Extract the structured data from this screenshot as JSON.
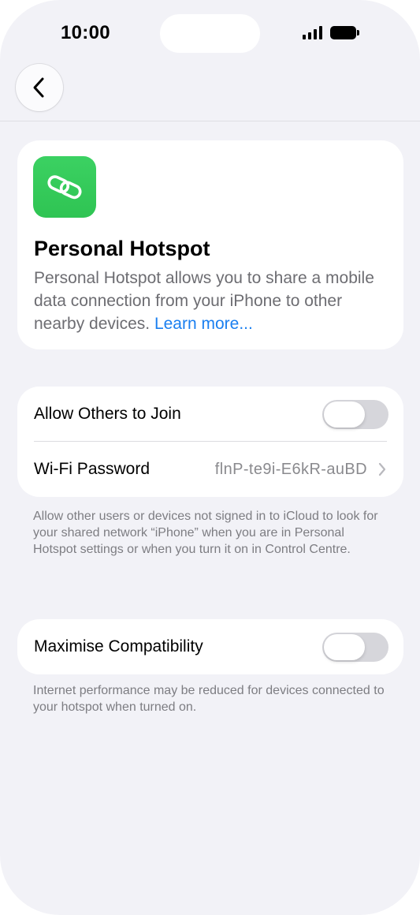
{
  "status_bar": {
    "time": "10:00",
    "signal_icon": "cellular-signal-icon",
    "battery_icon": "battery-icon"
  },
  "nav": {
    "back_icon": "chevron-left-icon"
  },
  "hero": {
    "icon": "link-chain-icon",
    "icon_color": "#34c759",
    "title": "Personal Hotspot",
    "description": "Personal Hotspot allows you to share a mobile data connection from your iPhone to other nearby devices.",
    "link_label": "Learn more..."
  },
  "settings": {
    "allow_others_label": "Allow Others to Join",
    "allow_others_enabled": false,
    "wifi_password_label": "Wi-Fi Password",
    "wifi_password_value": "flnP-te9i-E6kR-auBD",
    "footnote": "Allow other users or devices not signed in to iCloud to look for your shared network “iPhone” when you are in Personal Hotspot settings or when you turn it on in Control Centre."
  },
  "compatibility": {
    "label": "Maximise Compatibility",
    "enabled": false,
    "footnote": "Internet performance may be reduced for devices connected to your hotspot when turned on."
  },
  "colors": {
    "background": "#f2f2f7",
    "link": "#1a7ff0",
    "toggle_off": "#d6d6db"
  }
}
